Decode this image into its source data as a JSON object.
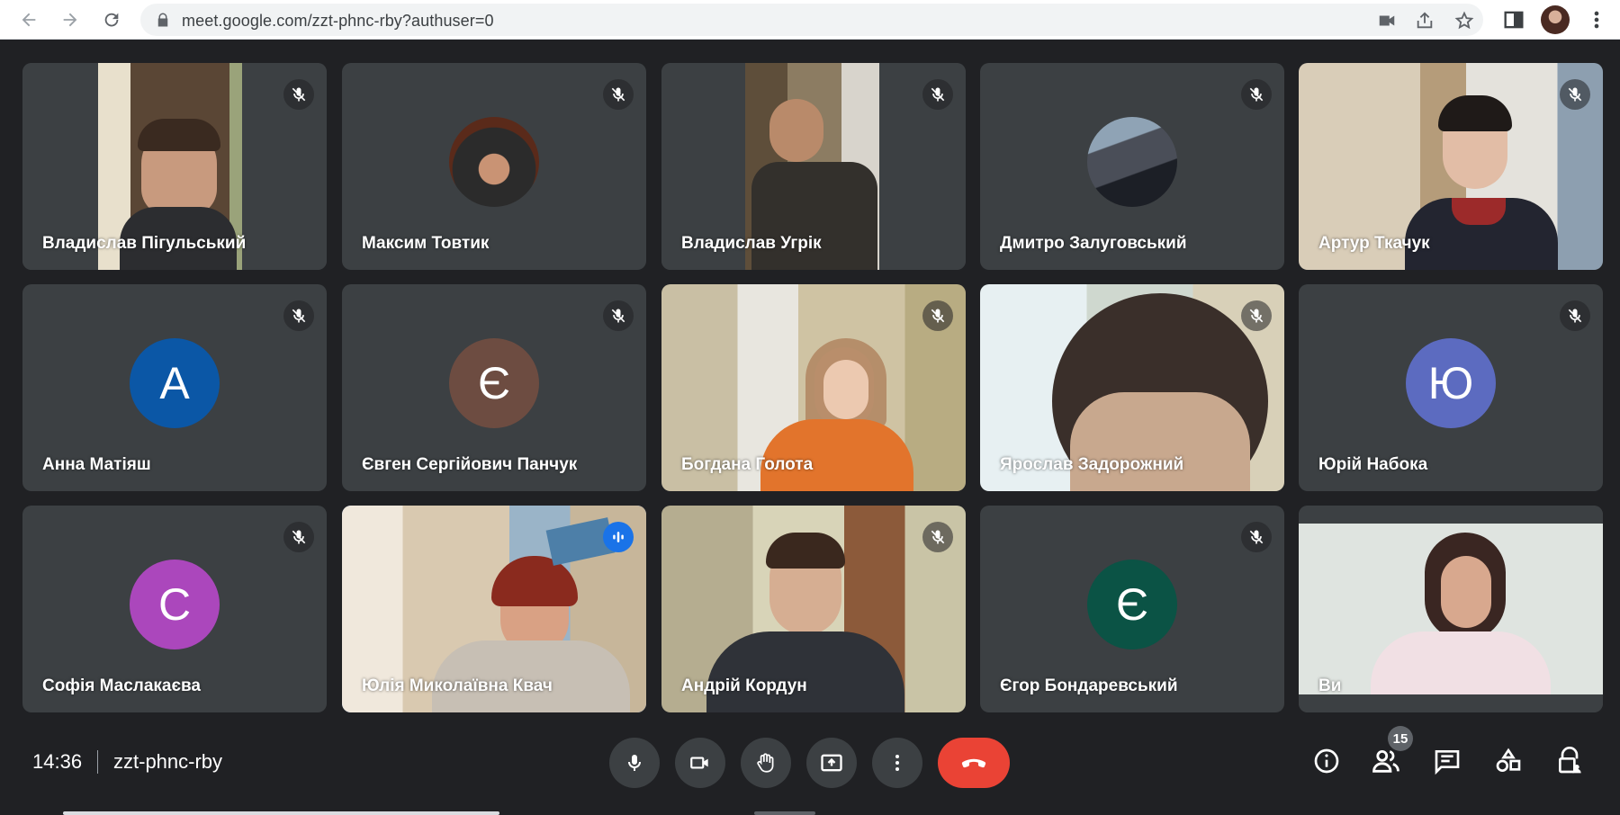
{
  "browser": {
    "url": "meet.google.com/zzt-phnc-rby?authuser=0"
  },
  "tiles": [
    {
      "name": "Владислав Пігульський",
      "muted": true,
      "kind": "video"
    },
    {
      "name": "Максим Товтик",
      "muted": true,
      "kind": "photo"
    },
    {
      "name": "Владислав Угрік",
      "muted": true,
      "kind": "video"
    },
    {
      "name": "Дмитро Залуговський",
      "muted": true,
      "kind": "photo"
    },
    {
      "name": "Артур Ткачук",
      "muted": true,
      "kind": "video"
    },
    {
      "name": "Анна Матіяш",
      "muted": true,
      "kind": "letter",
      "letter": "A",
      "color": "#0b57a6"
    },
    {
      "name": "Євген Сергійович Панчук",
      "muted": true,
      "kind": "letter",
      "letter": "Є",
      "color": "#6d4c41"
    },
    {
      "name": "Богдана Голота",
      "muted": true,
      "kind": "video"
    },
    {
      "name": "Ярослав Задорожний",
      "muted": true,
      "kind": "video"
    },
    {
      "name": "Юрій Набока",
      "muted": true,
      "kind": "letter",
      "letter": "Ю",
      "color": "#5c6bc0"
    },
    {
      "name": "Софія Маслакаєва",
      "muted": true,
      "kind": "letter",
      "letter": "С",
      "color": "#ab47bc"
    },
    {
      "name": "Юлія Миколаївна Квач",
      "muted": false,
      "speaking": true,
      "kind": "video"
    },
    {
      "name": "Андрій Кордун",
      "muted": true,
      "kind": "video"
    },
    {
      "name": "Єгор Бондаревський",
      "muted": true,
      "kind": "letter",
      "letter": "Є",
      "color": "#0b5345"
    },
    {
      "name": "Ви",
      "muted": false,
      "kind": "video"
    }
  ],
  "bottom": {
    "time": "14:36",
    "meeting_code": "zzt-phnc-rby",
    "participants_count": "15"
  },
  "colors": {
    "background": "#202124",
    "tile": "#3c4043",
    "end_call": "#ea4335",
    "active_outline": "#8ab4f8"
  }
}
